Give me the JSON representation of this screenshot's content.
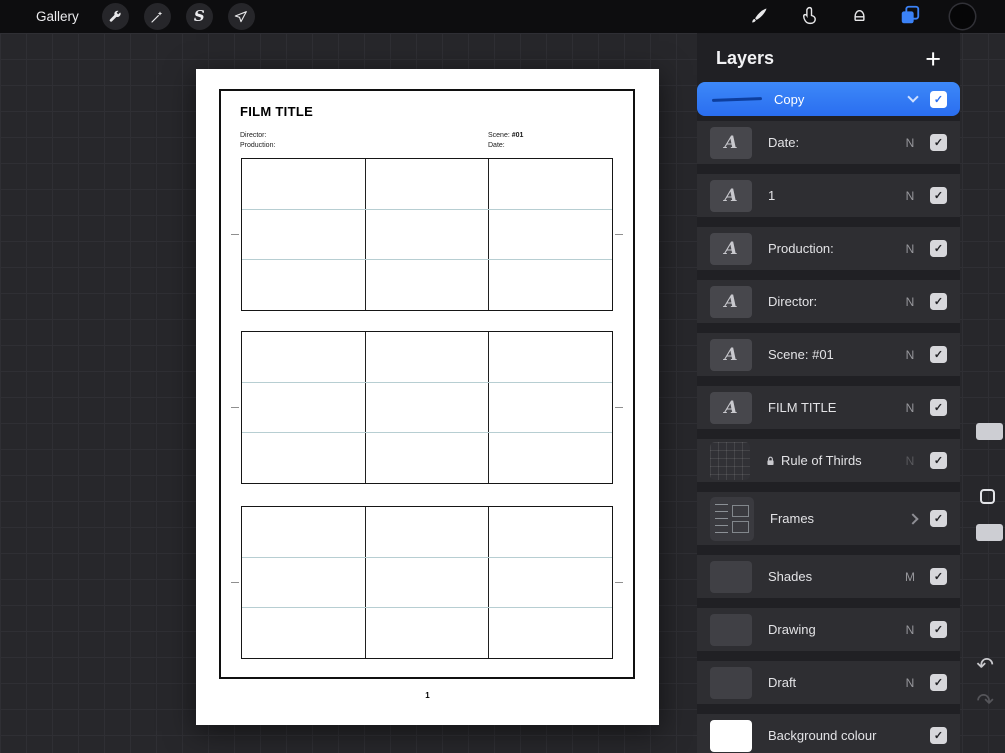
{
  "colors": {
    "accent_blue": "#2e7bf6",
    "panel_bg": "#202024",
    "row_bg": "#2e2e32",
    "canvas_bg": "#27272b"
  },
  "icons": {
    "check": "✓",
    "plus": "+",
    "undo": "↶",
    "redo": "↷",
    "selection_glyph": "S",
    "text_layer_glyph": "A"
  },
  "topbar": {
    "gallery_label": "Gallery"
  },
  "canvas": {
    "storyboard": {
      "title": "FILM TITLE",
      "director_label": "Director:",
      "production_label": "Production:",
      "scene_label": "Scene: ",
      "scene_value": "#01",
      "date_label": "Date:",
      "page_number": "1"
    }
  },
  "layers_panel": {
    "title": "Layers",
    "items": [
      {
        "name": "Copy",
        "thumb": "stroke",
        "selected": true,
        "chevron": "down",
        "checked": true
      },
      {
        "name": "Date:",
        "thumb": "text",
        "blend": "N",
        "checked": true
      },
      {
        "name": "1",
        "thumb": "text",
        "blend": "N",
        "checked": true
      },
      {
        "name": "Production:",
        "thumb": "text",
        "blend": "N",
        "checked": true
      },
      {
        "name": "Director:",
        "thumb": "text",
        "blend": "N",
        "checked": true
      },
      {
        "name": "Scene: #01",
        "thumb": "text",
        "blend": "N",
        "checked": true
      },
      {
        "name": "FILM TITLE",
        "thumb": "text",
        "blend": "N",
        "checked": true
      },
      {
        "name": "Rule of Thirds",
        "thumb": "grid",
        "blend": "N",
        "locked": true,
        "dimmed": true,
        "checked": true
      },
      {
        "name": "Frames",
        "thumb": "frames",
        "chevron": "right",
        "checked": true
      },
      {
        "name": "Shades",
        "thumb": "plain",
        "blend": "M",
        "checked": true
      },
      {
        "name": "Drawing",
        "thumb": "plain",
        "blend": "N",
        "checked": true
      },
      {
        "name": "Draft",
        "thumb": "plain",
        "blend": "N",
        "checked": true
      },
      {
        "name": "Background colour",
        "thumb": "white",
        "checked": true
      }
    ]
  }
}
